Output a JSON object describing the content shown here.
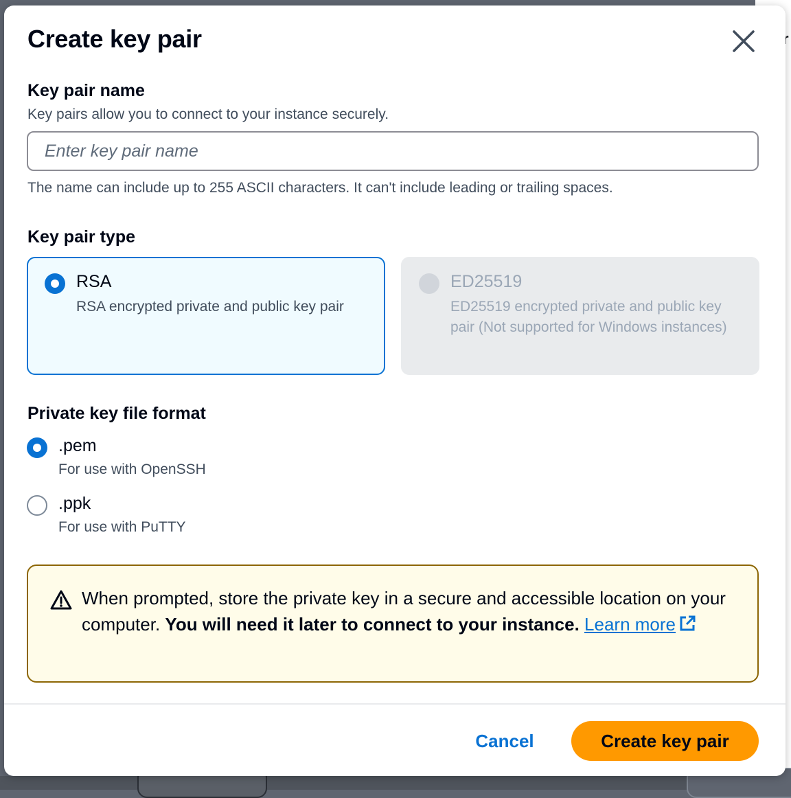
{
  "dialog": {
    "title": "Create key pair"
  },
  "key_pair_name": {
    "label": "Key pair name",
    "description": "Key pairs allow you to connect to your instance securely.",
    "placeholder": "Enter key pair name",
    "value": "",
    "constraint": "The name can include up to 255 ASCII characters. It can't include leading or trailing spaces."
  },
  "key_pair_type": {
    "label": "Key pair type",
    "options": [
      {
        "title": "RSA",
        "description": "RSA encrypted private and public key pair",
        "selected": true,
        "disabled": false
      },
      {
        "title": "ED25519",
        "description": "ED25519 encrypted private and public key pair (Not supported for Windows instances)",
        "selected": false,
        "disabled": true
      }
    ]
  },
  "file_format": {
    "label": "Private key file format",
    "options": [
      {
        "title": ".pem",
        "description": "For use with OpenSSH",
        "checked": true
      },
      {
        "title": ".ppk",
        "description": "For use with PuTTY",
        "checked": false
      }
    ]
  },
  "alert": {
    "text_normal": "When prompted, store the private key in a secure and accessible location on your computer. ",
    "text_bold": "You will need it later to connect to your instance.",
    "link_label": "Learn more"
  },
  "footer": {
    "cancel_label": "Cancel",
    "create_label": "Create key pair"
  },
  "colors": {
    "accent": "#0972d3",
    "primary_button": "#ff9900",
    "warning_border": "#8d6605",
    "warning_bg": "#fffce9"
  },
  "icons": {
    "close": "close-icon",
    "warning": "warning-icon",
    "external_link": "external-link-icon"
  }
}
